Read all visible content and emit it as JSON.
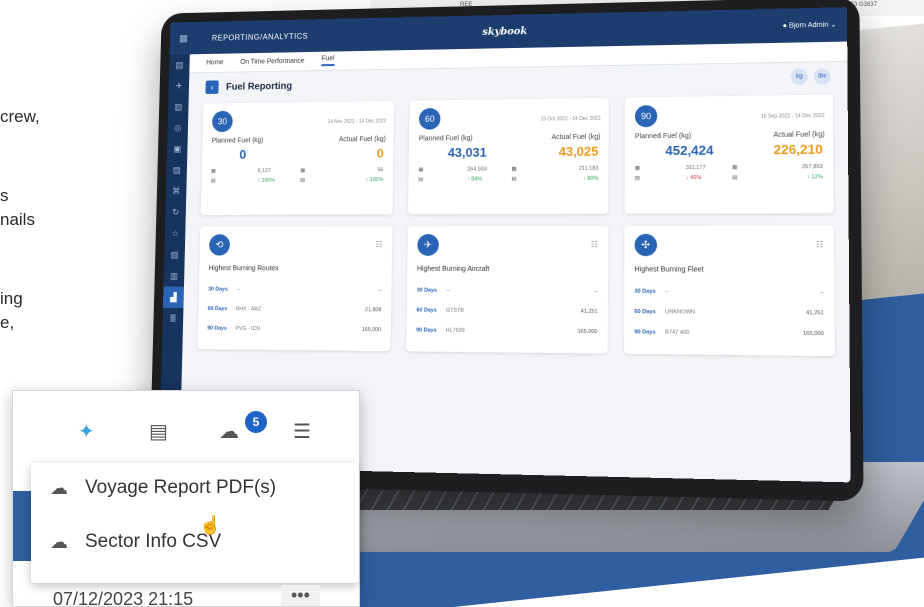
{
  "marketing": {
    "line1": "crew,",
    "line2": "s",
    "line3": "nails",
    "line4": "ing",
    "line5": "e,"
  },
  "top_strip": {
    "left_fragment": "REE",
    "right_fragment": "B1223 G3637"
  },
  "app": {
    "section": "REPORTING/ANALYTICS",
    "logo": "skybook",
    "user": "Bjorn Admin"
  },
  "tabs": [
    {
      "label": "Home"
    },
    {
      "label": "On Time Performance"
    },
    {
      "label": "Fuel",
      "active": true
    }
  ],
  "page": {
    "title": "Fuel Reporting",
    "unit_options": [
      "kg",
      "lbs"
    ]
  },
  "fuel_cards": [
    {
      "days": "30",
      "days_label": "DAYS",
      "range": "14 Nov 2022 - 14 Dec 2022",
      "planned_label": "Planned Fuel (kg)",
      "actual_label": "Actual Fuel (kg)",
      "planned": "0",
      "actual": "0",
      "planned_prev": "8,127",
      "planned_pct": "↑ 100%",
      "actual_prev": "56",
      "actual_pct": "↑ 100%",
      "planned_pct_color": "green"
    },
    {
      "days": "60",
      "days_label": "DAYS",
      "range": "15 Oct 2022 - 14 Dec 2022",
      "planned_label": "Planned Fuel (kg)",
      "actual_label": "Actual Fuel (kg)",
      "planned": "43,031",
      "actual": "43,025",
      "planned_prev": "264,933",
      "planned_pct": "↑ 84%",
      "actual_prev": "211,183",
      "actual_pct": "↑ 80%",
      "planned_pct_color": "green"
    },
    {
      "days": "90",
      "days_label": "DAYS",
      "range": "15 Sep 2022 - 14 Dec 2022",
      "planned_label": "Planned Fuel (kg)",
      "actual_label": "Actual Fuel (kg)",
      "planned": "452,424",
      "actual": "226,210",
      "planned_prev": "311,177",
      "planned_pct": "↓ 45%",
      "actual_prev": "257,853",
      "actual_pct": "↑ 12%",
      "planned_pct_color": "red"
    }
  ],
  "burning_cards": [
    {
      "title": "Highest Burning Routes",
      "icon": "route-icon",
      "rows": [
        {
          "days": "30 Days",
          "name": "--",
          "value": "--"
        },
        {
          "days": "60 Days",
          "name": "BHX - ABZ",
          "value": "21,808"
        },
        {
          "days": "90 Days",
          "name": "PVG - ICN",
          "value": "165,000"
        }
      ]
    },
    {
      "title": "Highest Burning Aircraft",
      "icon": "airplane-icon",
      "rows": [
        {
          "days": "30 Days",
          "name": "--",
          "value": "--"
        },
        {
          "days": "60 Days",
          "name": "GTSTB",
          "value": "41,251"
        },
        {
          "days": "90 Days",
          "name": "HL7639",
          "value": "165,000"
        }
      ]
    },
    {
      "title": "Highest Burning Fleet",
      "icon": "fleet-icon",
      "rows": [
        {
          "days": "30 Days",
          "name": "--",
          "value": "--"
        },
        {
          "days": "60 Days",
          "name": "UNKNOWN",
          "value": "41,251"
        },
        {
          "days": "90 Days",
          "name": "B747 400",
          "value": "165,000"
        }
      ]
    }
  ],
  "popup": {
    "notification_count": "5",
    "menu": [
      {
        "label": "Voyage Report PDF(s)",
        "icon": "cloud-download-icon"
      },
      {
        "label": "Sector Info CSV",
        "icon": "cloud-download-icon"
      }
    ],
    "date": "07/12/2023 21:15",
    "more": "•••"
  },
  "colors": {
    "brand_dark": "#1d3d6e",
    "accent_blue": "#2a64b6",
    "actual_orange": "#ef9b24",
    "pct_green": "#2a9d5a",
    "pct_red": "#d23b3b",
    "background_band": "#2f5fa0"
  }
}
